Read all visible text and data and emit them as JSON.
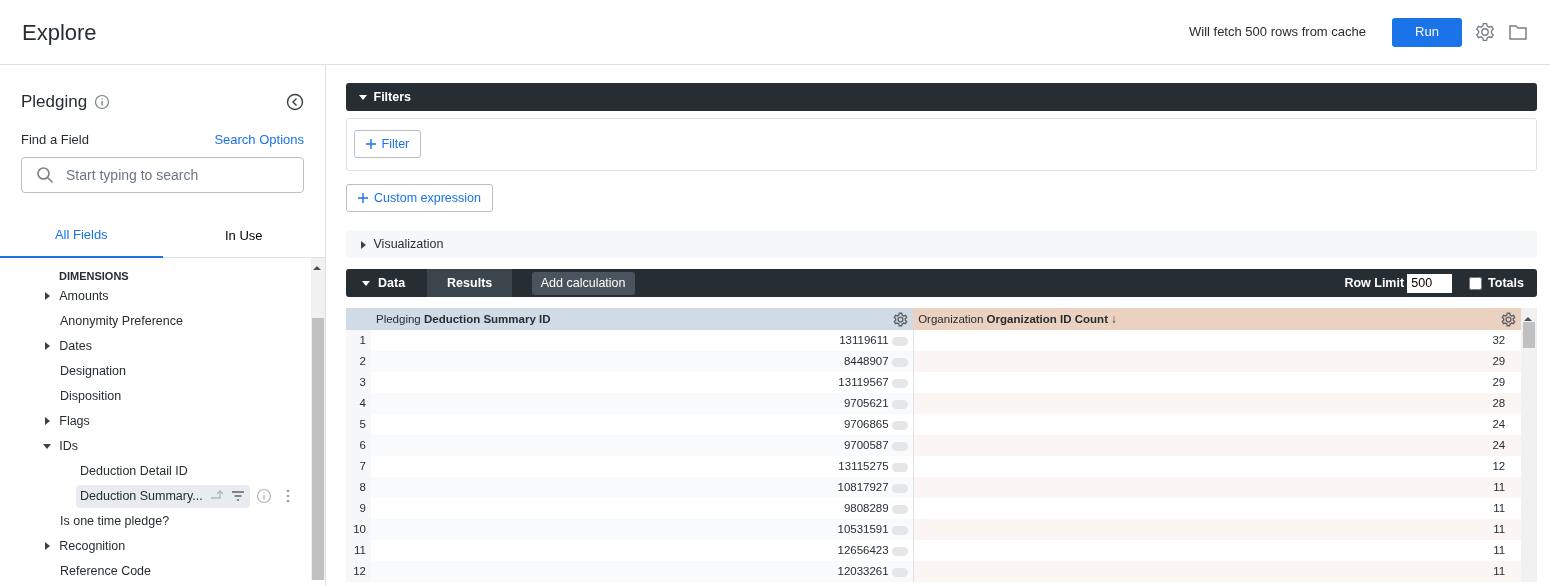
{
  "header": {
    "title": "Explore",
    "cache_note": "Will fetch 500 rows from cache",
    "run_button": "Run"
  },
  "sidebar": {
    "title": "Pledging",
    "find_label": "Find a Field",
    "search_options": "Search Options",
    "search": {
      "placeholder": "Start typing to search"
    },
    "tabs": [
      {
        "label": "All Fields",
        "selected": true
      },
      {
        "label": "In Use",
        "selected": false
      }
    ],
    "section_heading": "DIMENSIONS",
    "items": [
      {
        "label": "Amounts",
        "kind": "group",
        "expanded": false
      },
      {
        "label": "Anonymity Preference",
        "kind": "field",
        "selected": false
      },
      {
        "label": "Dates",
        "kind": "group",
        "expanded": false
      },
      {
        "label": "Designation",
        "kind": "field",
        "selected": false
      },
      {
        "label": "Disposition",
        "kind": "field",
        "selected": false
      },
      {
        "label": "Flags",
        "kind": "group",
        "expanded": false
      },
      {
        "label": "IDs",
        "kind": "group",
        "expanded": true,
        "children": [
          {
            "label": "Deduction Detail ID",
            "kind": "field",
            "selected": false
          },
          {
            "label": "Deduction Summary...",
            "kind": "field",
            "selected": true
          }
        ]
      },
      {
        "label": "Is one time pledge?",
        "kind": "field",
        "selected": false
      },
      {
        "label": "Recognition",
        "kind": "group",
        "expanded": false
      },
      {
        "label": "Reference Code",
        "kind": "field",
        "selected": false
      }
    ]
  },
  "filters": {
    "title": "Filters",
    "expanded": true,
    "filter_button": "Filter",
    "custom_expression_button": "Custom expression"
  },
  "visualization": {
    "title": "Visualization",
    "expanded": false
  },
  "data": {
    "title": "Data",
    "expanded": true,
    "tabs": [
      {
        "label": "Results",
        "selected": true
      }
    ],
    "add_calculation": "Add calculation",
    "row_limit_label": "Row Limit",
    "row_limit": "500",
    "totals_label": "Totals",
    "totals_checked": false,
    "table": {
      "columns": [
        {
          "kind": "index"
        },
        {
          "view": "Pledging",
          "field": "Deduction Summary ID",
          "kind": "dimension"
        },
        {
          "view": "Organization",
          "field": "Organization ID Count ↓",
          "kind": "measure"
        }
      ],
      "rows": [
        [
          "1",
          "13119611",
          "32"
        ],
        [
          "2",
          "8448907",
          "29"
        ],
        [
          "3",
          "13119567",
          "29"
        ],
        [
          "4",
          "9705621",
          "28"
        ],
        [
          "5",
          "9706865",
          "24"
        ],
        [
          "6",
          "9700587",
          "24"
        ],
        [
          "7",
          "13115275",
          "12"
        ],
        [
          "8",
          "10817927",
          "11"
        ],
        [
          "9",
          "9808289",
          "11"
        ],
        [
          "10",
          "10531591",
          "11"
        ],
        [
          "11",
          "12656423",
          "11"
        ],
        [
          "12",
          "12033261",
          "11"
        ]
      ]
    }
  }
}
